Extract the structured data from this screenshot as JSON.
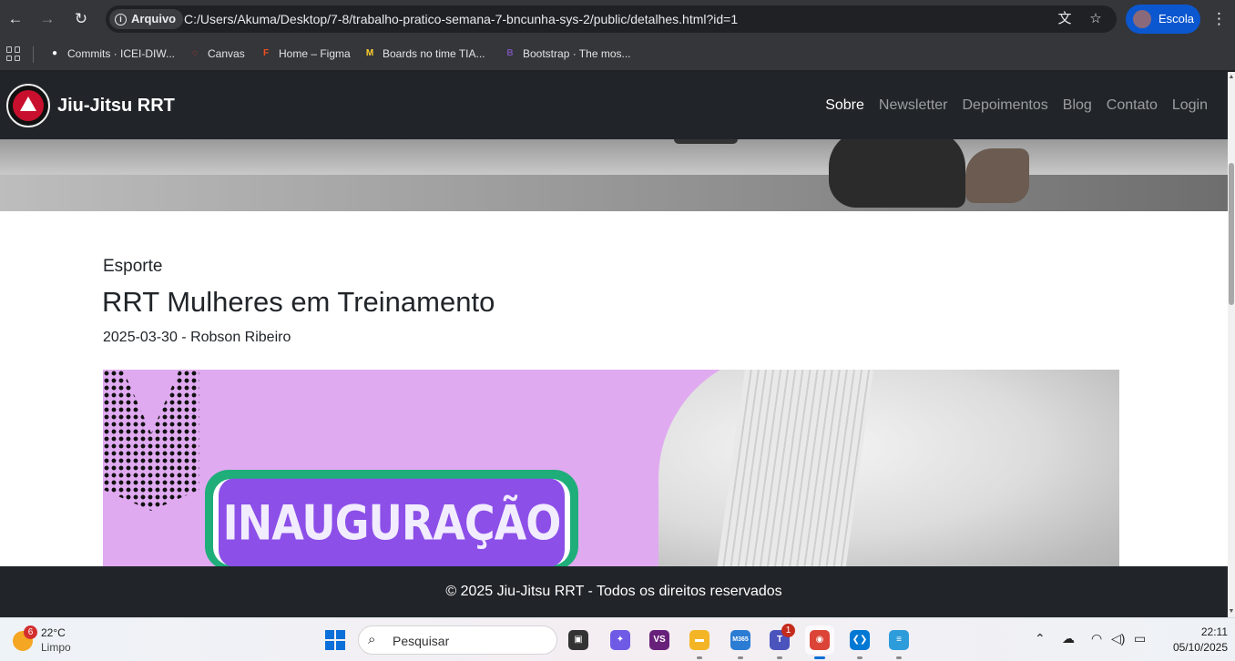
{
  "browser": {
    "back_icon": "←",
    "forward_icon": "→",
    "reload_icon": "↻",
    "info_chip_label": "Arquivo",
    "url": "C:/Users/Akuma/Desktop/7-8/trabalho-pratico-semana-7-bncunha-sys-2/public/detalhes.html?id=1",
    "translate_icon": "文",
    "star_icon": "☆",
    "profile_label": "Escola",
    "menu_icon": "⋮"
  },
  "bookmarks": [
    {
      "label": "Commits · ICEI-DIW...",
      "icon": "github-icon",
      "color": "#ffffff",
      "glyph": "●"
    },
    {
      "label": "Canvas",
      "icon": "canvas-icon",
      "color": "#e13b2a",
      "glyph": "◌"
    },
    {
      "label": "Home – Figma",
      "icon": "figma-icon",
      "color": "#f24e1e",
      "glyph": "F"
    },
    {
      "label": "Boards no time TIA...",
      "icon": "miro-icon",
      "color": "#ffd02f",
      "glyph": "M"
    },
    {
      "label": "Bootstrap · The mos...",
      "icon": "bootstrap-icon",
      "color": "#7952b3",
      "glyph": "B"
    }
  ],
  "site": {
    "brand": "Jiu-Jitsu RRT",
    "nav": [
      {
        "label": "Sobre",
        "active": true
      },
      {
        "label": "Newsletter",
        "active": false
      },
      {
        "label": "Depoimentos",
        "active": false
      },
      {
        "label": "Blog",
        "active": false
      },
      {
        "label": "Contato",
        "active": false
      },
      {
        "label": "Login",
        "active": false
      }
    ]
  },
  "article": {
    "category": "Esporte",
    "title": "RRT Mulheres em Treinamento",
    "meta": "2025-03-30 - Robson Ribeiro",
    "banner_text": "INAUGURAÇÃO"
  },
  "footer": {
    "text": "© 2025 Jiu-Jitsu RRT - Todos os direitos reservados"
  },
  "taskbar": {
    "weather_temp": "22°C",
    "weather_condition": "Limpo",
    "weather_badge": "6",
    "search_placeholder": "Pesquisar",
    "apps": [
      {
        "name": "task-view",
        "color": "#333333",
        "glyph": "▣",
        "running": false
      },
      {
        "name": "copilot",
        "color": "#6f5ae6",
        "glyph": "✦",
        "running": false
      },
      {
        "name": "visual-studio",
        "color": "#68217a",
        "glyph": "VS",
        "running": false
      },
      {
        "name": "file-explorer",
        "color": "#f3b526",
        "glyph": "▬",
        "running": true
      },
      {
        "name": "microsoft-365",
        "color": "#2b7cd3",
        "glyph": "M365",
        "running": true
      },
      {
        "name": "teams",
        "color": "#4b53bc",
        "glyph": "T",
        "running": true,
        "badge": "1"
      },
      {
        "name": "chrome",
        "color": "#db4437",
        "glyph": "◉",
        "running": true,
        "active": true
      },
      {
        "name": "vscode",
        "color": "#0078d4",
        "glyph": "❮❯",
        "running": true
      },
      {
        "name": "notepad",
        "color": "#2d9cdb",
        "glyph": "≡",
        "running": true
      }
    ],
    "tray_chevron": "⌃",
    "time": "22:11",
    "date": "05/10/2025"
  }
}
